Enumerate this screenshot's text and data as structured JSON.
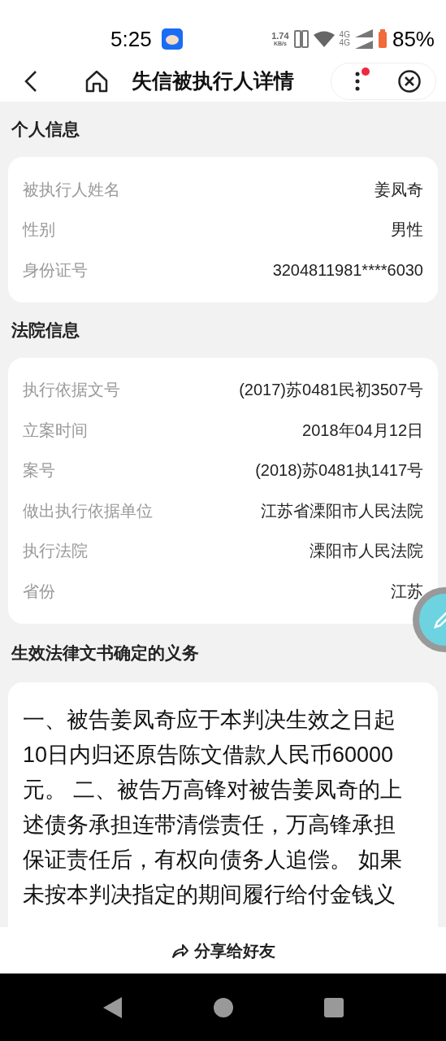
{
  "status_bar": {
    "time": "5:25",
    "speed_value": "1.74",
    "speed_unit": "KB/s",
    "network_labels": [
      "4G",
      "4G"
    ],
    "battery": "85%"
  },
  "nav": {
    "title": "失信被执行人详情",
    "has_notification": true
  },
  "sections": [
    {
      "title": "个人信息",
      "rows": [
        {
          "label": "被执行人姓名",
          "value": "姜凤奇"
        },
        {
          "label": "性别",
          "value": "男性"
        },
        {
          "label": "身份证号",
          "value": "3204811981****6030"
        }
      ]
    },
    {
      "title": "法院信息",
      "rows": [
        {
          "label": "执行依据文号",
          "value": "(2017)苏0481民初3507号"
        },
        {
          "label": "立案时间",
          "value": "2018年04月12日"
        },
        {
          "label": "案号",
          "value": "(2018)苏0481执1417号"
        },
        {
          "label": "做出执行依据单位",
          "value": "江苏省溧阳市人民法院"
        },
        {
          "label": "执行法院",
          "value": "溧阳市人民法院"
        },
        {
          "label": "省份",
          "value": "江苏"
        }
      ]
    }
  ],
  "duty": {
    "title": "生效法律文书确定的义务",
    "text": "一、被告姜凤奇应于本判决生效之日起10日内归还原告陈文借款人民币60000元。 二、被告万高锋对被告姜凤奇的上述债务承担连带清偿责任，万高锋承担保证责任后，有权向债务人追偿。 如果未按本判决指定的期间履行给付金钱义"
  },
  "share": {
    "label": "分享给好友"
  }
}
